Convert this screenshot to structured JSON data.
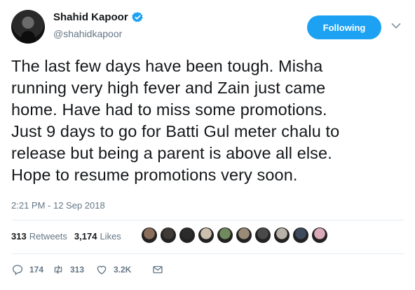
{
  "author": {
    "name": "Shahid Kapoor",
    "handle": "@shahidkapoor",
    "verified_icon": "verified-badge-icon"
  },
  "follow_button": {
    "label": "Following"
  },
  "tweet": {
    "text": "The last few days have been tough. Misha\nrunning very high fever and Zain just came\nhome. Have had to miss some promotions.\nJust 9 days to go for Batti Gul meter chalu to\nrelease but being a parent is above all else.\nHope to resume promotions very soon.",
    "timestamp": "2:21 PM - 12 Sep 2018"
  },
  "stats": {
    "retweets_count": "313",
    "retweets_label": "Retweets",
    "likes_count": "3,174",
    "likes_label": "Likes"
  },
  "liker_avatars": [
    "#8a6d5a",
    "#3f3a36",
    "#2b2b2b",
    "#cbbfae",
    "#6f8b5e",
    "#9a8a78",
    "#4a4a4a",
    "#b9b2aa",
    "#3d4a5e",
    "#d9a9b8"
  ],
  "actions": {
    "reply_count": "174",
    "retweet_count": "313",
    "like_count": "3.2K"
  },
  "colors": {
    "accent": "#1da1f2",
    "muted": "#657786",
    "text": "#14171a"
  }
}
